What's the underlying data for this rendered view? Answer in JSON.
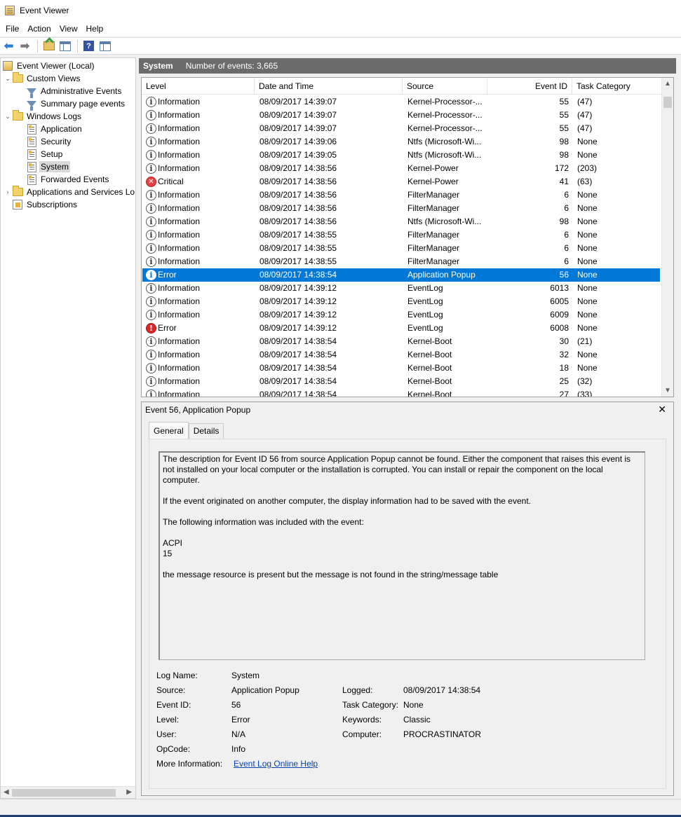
{
  "window": {
    "title": "Event Viewer"
  },
  "menu": [
    "File",
    "Action",
    "View",
    "Help"
  ],
  "toolbar": {
    "help_label": "?"
  },
  "tree": {
    "items": [
      {
        "label": "Event Viewer (Local)",
        "icon": "event-viewer-icon",
        "expander": "",
        "indent": 0
      },
      {
        "label": "Custom Views",
        "icon": "folder-icon",
        "expander": "⌄",
        "indent": 1
      },
      {
        "label": "Administrative Events",
        "icon": "filter-icon",
        "expander": "",
        "indent": 2
      },
      {
        "label": "Summary page events",
        "icon": "filter-icon",
        "expander": "",
        "indent": 2
      },
      {
        "label": "Windows Logs",
        "icon": "folder-icon",
        "expander": "⌄",
        "indent": 1
      },
      {
        "label": "Application",
        "icon": "log-icon",
        "expander": "",
        "indent": 2
      },
      {
        "label": "Security",
        "icon": "log-icon",
        "expander": "",
        "indent": 2
      },
      {
        "label": "Setup",
        "icon": "log-icon",
        "expander": "",
        "indent": 2
      },
      {
        "label": "System",
        "icon": "log-icon",
        "expander": "",
        "indent": 2,
        "selected": true
      },
      {
        "label": "Forwarded Events",
        "icon": "log-icon",
        "expander": "",
        "indent": 2
      },
      {
        "label": "Applications and Services Lo",
        "icon": "folder-icon",
        "expander": "›",
        "indent": 1
      },
      {
        "label": "Subscriptions",
        "icon": "subscriptions-icon",
        "expander": "",
        "indent": 1
      }
    ]
  },
  "header": {
    "log_name": "System",
    "count_text": "Number of events: 3,665"
  },
  "columns": {
    "level": "Level",
    "date": "Date and Time",
    "source": "Source",
    "event_id": "Event ID",
    "task": "Task Category"
  },
  "events": [
    {
      "level": "Information",
      "type": "info",
      "date": "08/09/2017 14:39:07",
      "source": "Kernel-Processor-...",
      "id": "55",
      "task": "(47)"
    },
    {
      "level": "Information",
      "type": "info",
      "date": "08/09/2017 14:39:07",
      "source": "Kernel-Processor-...",
      "id": "55",
      "task": "(47)"
    },
    {
      "level": "Information",
      "type": "info",
      "date": "08/09/2017 14:39:07",
      "source": "Kernel-Processor-...",
      "id": "55",
      "task": "(47)"
    },
    {
      "level": "Information",
      "type": "info",
      "date": "08/09/2017 14:39:06",
      "source": "Ntfs (Microsoft-Wi...",
      "id": "98",
      "task": "None"
    },
    {
      "level": "Information",
      "type": "info",
      "date": "08/09/2017 14:39:05",
      "source": "Ntfs (Microsoft-Wi...",
      "id": "98",
      "task": "None"
    },
    {
      "level": "Information",
      "type": "info",
      "date": "08/09/2017 14:38:56",
      "source": "Kernel-Power",
      "id": "172",
      "task": "(203)"
    },
    {
      "level": "Critical",
      "type": "critical",
      "date": "08/09/2017 14:38:56",
      "source": "Kernel-Power",
      "id": "41",
      "task": "(63)"
    },
    {
      "level": "Information",
      "type": "info",
      "date": "08/09/2017 14:38:56",
      "source": "FilterManager",
      "id": "6",
      "task": "None"
    },
    {
      "level": "Information",
      "type": "info",
      "date": "08/09/2017 14:38:56",
      "source": "FilterManager",
      "id": "6",
      "task": "None"
    },
    {
      "level": "Information",
      "type": "info",
      "date": "08/09/2017 14:38:56",
      "source": "Ntfs (Microsoft-Wi...",
      "id": "98",
      "task": "None"
    },
    {
      "level": "Information",
      "type": "info",
      "date": "08/09/2017 14:38:55",
      "source": "FilterManager",
      "id": "6",
      "task": "None"
    },
    {
      "level": "Information",
      "type": "info",
      "date": "08/09/2017 14:38:55",
      "source": "FilterManager",
      "id": "6",
      "task": "None"
    },
    {
      "level": "Information",
      "type": "info",
      "date": "08/09/2017 14:38:55",
      "source": "FilterManager",
      "id": "6",
      "task": "None"
    },
    {
      "level": "Error",
      "type": "selinfo",
      "date": "08/09/2017 14:38:54",
      "source": "Application Popup",
      "id": "56",
      "task": "None",
      "selected": true
    },
    {
      "level": "Information",
      "type": "info",
      "date": "08/09/2017 14:39:12",
      "source": "EventLog",
      "id": "6013",
      "task": "None"
    },
    {
      "level": "Information",
      "type": "info",
      "date": "08/09/2017 14:39:12",
      "source": "EventLog",
      "id": "6005",
      "task": "None"
    },
    {
      "level": "Information",
      "type": "info",
      "date": "08/09/2017 14:39:12",
      "source": "EventLog",
      "id": "6009",
      "task": "None"
    },
    {
      "level": "Error",
      "type": "error",
      "date": "08/09/2017 14:39:12",
      "source": "EventLog",
      "id": "6008",
      "task": "None"
    },
    {
      "level": "Information",
      "type": "info",
      "date": "08/09/2017 14:38:54",
      "source": "Kernel-Boot",
      "id": "30",
      "task": "(21)"
    },
    {
      "level": "Information",
      "type": "info",
      "date": "08/09/2017 14:38:54",
      "source": "Kernel-Boot",
      "id": "32",
      "task": "None"
    },
    {
      "level": "Information",
      "type": "info",
      "date": "08/09/2017 14:38:54",
      "source": "Kernel-Boot",
      "id": "18",
      "task": "None"
    },
    {
      "level": "Information",
      "type": "info",
      "date": "08/09/2017 14:38:54",
      "source": "Kernel-Boot",
      "id": "25",
      "task": "(32)"
    },
    {
      "level": "Information",
      "type": "info",
      "date": "08/09/2017 14:38:54",
      "source": "Kernel-Boot",
      "id": "27",
      "task": "(33)"
    }
  ],
  "detail": {
    "title": "Event 56, Application Popup",
    "close": "✕",
    "tabs": [
      "General",
      "Details"
    ],
    "description": "The description for Event ID 56 from source Application Popup cannot be found. Either the component that raises this event is not installed on your local computer or the installation is corrupted. You can install or repair the component on the local computer.\n\nIf the event originated on another computer, the display information had to be saved with the event.\n\nThe following information was included with the event:\n\nACPI\n15\n\nthe message resource is present but the message is not found in the string/message table",
    "fields": {
      "log_name_label": "Log Name:",
      "log_name": "System",
      "source_label": "Source:",
      "source": "Application Popup",
      "logged_label": "Logged:",
      "logged": "08/09/2017 14:38:54",
      "event_id_label": "Event ID:",
      "event_id": "56",
      "task_label": "Task Category:",
      "task": "None",
      "level_label": "Level:",
      "level": "Error",
      "keywords_label": "Keywords:",
      "keywords": "Classic",
      "user_label": "User:",
      "user": "N/A",
      "computer_label": "Computer:",
      "computer": "PROCRASTINATOR",
      "opcode_label": "OpCode:",
      "opcode": "Info",
      "more_label": "More Information:",
      "more_link": "Event Log Online Help"
    }
  }
}
